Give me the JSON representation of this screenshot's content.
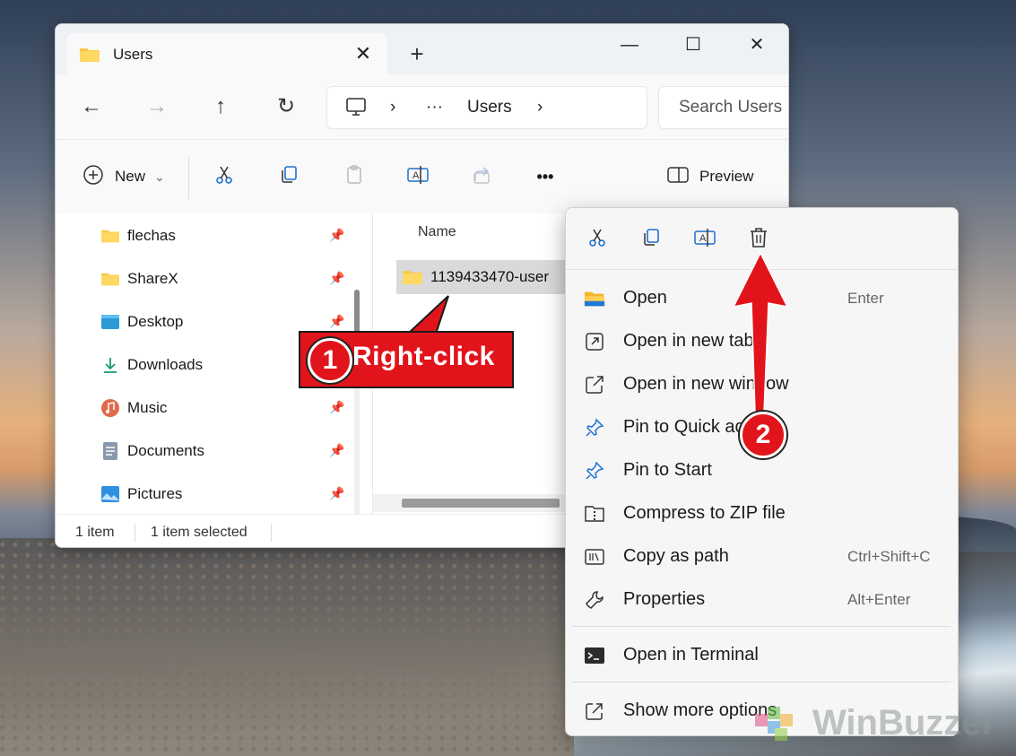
{
  "window": {
    "tab_title": "Users",
    "close_tab": "✕",
    "new_tab": "+",
    "controls": {
      "minimize": "—",
      "maximize": "☐",
      "close": "✕"
    }
  },
  "nav": {
    "back": "←",
    "forward": "→",
    "up": "↑",
    "refresh": "↻",
    "address": {
      "chevron1": "›",
      "ellipsis": "···",
      "crumb": "Users",
      "chevron2": "›"
    },
    "search_placeholder": "Search Users"
  },
  "toolbar": {
    "new_label": "New",
    "new_chevron": "⌄",
    "more": "•••",
    "preview_label": "Preview"
  },
  "sidebar": {
    "items": [
      {
        "label": "flechas",
        "icon": "folder-icon",
        "pinned": true
      },
      {
        "label": "ShareX",
        "icon": "folder-icon",
        "pinned": true
      },
      {
        "label": "Desktop",
        "icon": "desktop-icon",
        "pinned": true
      },
      {
        "label": "Downloads",
        "icon": "download-icon",
        "pinned": false
      },
      {
        "label": "Music",
        "icon": "music-icon",
        "pinned": true
      },
      {
        "label": "Documents",
        "icon": "documents-icon",
        "pinned": true
      },
      {
        "label": "Pictures",
        "icon": "pictures-icon",
        "pinned": true
      }
    ],
    "pin_glyph": "📌"
  },
  "files": {
    "column_header": "Name",
    "items": [
      {
        "name": "1139433470-user"
      }
    ]
  },
  "status": {
    "count": "1 item",
    "selection": "1 item selected"
  },
  "context_menu": {
    "items": [
      {
        "label": "Open",
        "shortcut": "Enter",
        "icon": "open-folder-icon"
      },
      {
        "label": "Open in new tab",
        "shortcut": "",
        "icon": "new-tab-icon"
      },
      {
        "label": "Open in new window",
        "shortcut": "",
        "icon": "new-window-icon"
      },
      {
        "label": "Pin to Quick access",
        "shortcut": "",
        "icon": "pin-icon"
      },
      {
        "label": "Pin to Start",
        "shortcut": "",
        "icon": "pin-icon"
      },
      {
        "label": "Compress to ZIP file",
        "shortcut": "",
        "icon": "zip-icon"
      },
      {
        "label": "Copy as path",
        "shortcut": "Ctrl+Shift+C",
        "icon": "copy-path-icon"
      },
      {
        "label": "Properties",
        "shortcut": "Alt+Enter",
        "icon": "wrench-icon"
      },
      {
        "label": "Open in Terminal",
        "shortcut": "",
        "icon": "terminal-icon"
      },
      {
        "label": "Show more options",
        "shortcut": "",
        "icon": "more-options-icon"
      }
    ]
  },
  "annotations": {
    "step1_number": "1",
    "step1_text": "Right-click",
    "step2_number": "2",
    "accent": "#e2141b"
  },
  "watermark": "WinBuzzer"
}
